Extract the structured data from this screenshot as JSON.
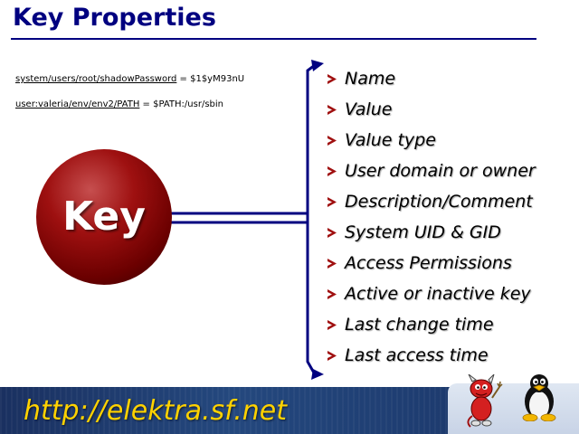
{
  "title": "Key Properties",
  "examples": [
    {
      "path": "system/users/root/shadowPassword",
      "rest": " = $1$yM93nU"
    },
    {
      "path": "user:valeria/env/env2/PATH",
      "rest": " = $PATH:/usr/sbin"
    }
  ],
  "key_label": "Key",
  "properties": [
    "Name",
    "Value",
    "Value type",
    "User domain or owner",
    "Description/Comment",
    "System UID & GID",
    "Access Permissions",
    "Active or inactive key",
    "Last change time",
    "Last access time"
  ],
  "footer": {
    "url": "http://elektra.sf.net"
  },
  "colors": {
    "title": "#000080",
    "bullet": "#a01010",
    "connector": "#000080",
    "sphere": "#9e1010",
    "footer_bg": "#1e3c70",
    "footer_url": "#ffd200"
  },
  "icons": [
    "bsd-daemon-icon",
    "linux-tux-icon"
  ]
}
